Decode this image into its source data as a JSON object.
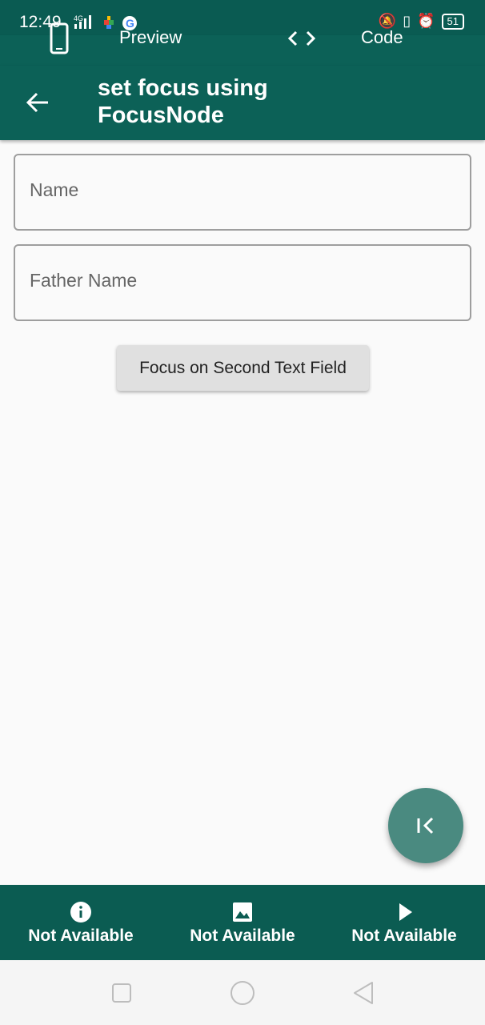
{
  "status_bar": {
    "time": "12:49",
    "network": "4G",
    "battery": "51"
  },
  "tabs": {
    "preview_label": "Preview",
    "code_label": "Code"
  },
  "app_bar": {
    "title": "set focus using FocusNode"
  },
  "form": {
    "name_placeholder": "Name",
    "father_name_placeholder": "Father Name",
    "focus_button_label": "Focus on Second Text Field"
  },
  "bottom_bar": {
    "items": [
      {
        "label": "Not Available",
        "icon": "info-icon"
      },
      {
        "label": "Not Available",
        "icon": "image-icon"
      },
      {
        "label": "Not Available",
        "icon": "play-icon"
      }
    ]
  },
  "colors": {
    "primary": "#0c6157",
    "fab": "#4a8a80",
    "background": "#fafafa"
  }
}
